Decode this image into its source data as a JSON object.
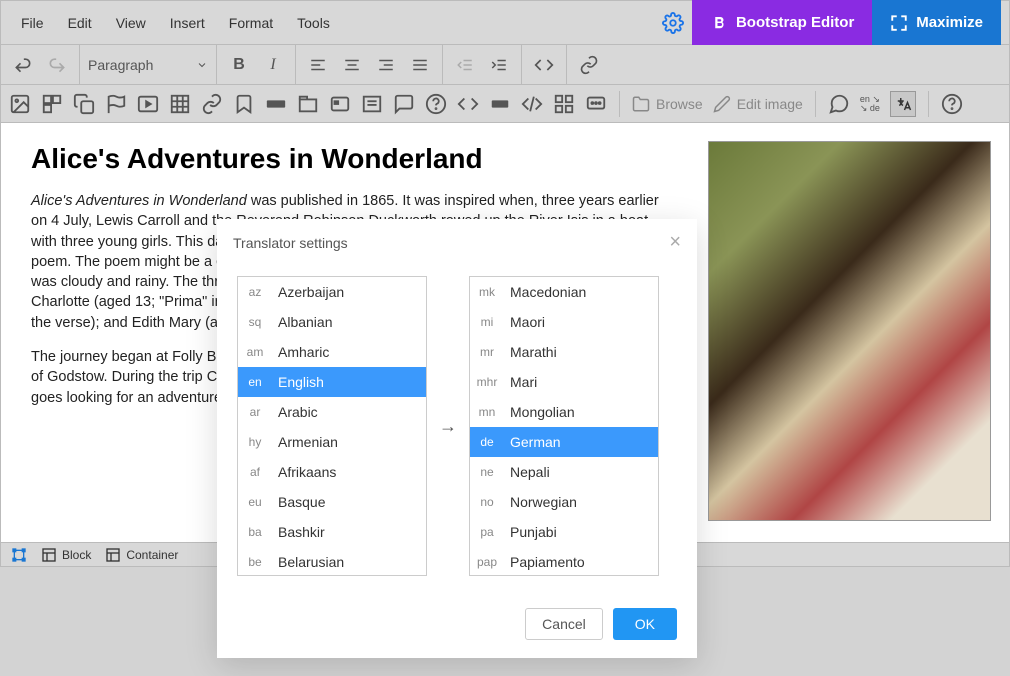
{
  "menubar": {
    "items": [
      "File",
      "Edit",
      "View",
      "Insert",
      "Format",
      "Tools"
    ],
    "bootstrap": "Bootstrap Editor",
    "maximize": "Maximize"
  },
  "toolbar": {
    "paragraph": "Paragraph",
    "browse": "Browse",
    "editimage": "Edit image",
    "lang_from": "en",
    "lang_arrow": "↘",
    "lang_to": "de"
  },
  "status": {
    "block": "Block",
    "container": "Container"
  },
  "content": {
    "title": "Alice's Adventures in Wonderland",
    "p1_em": "Alice's Adventures in Wonderland",
    "p1_rest": " was published in 1865. It was inspired when, three years earlier on 4 July, Lewis Carroll and the Reverend Robinson Duckworth rowed up the River Isis in a boat with three young girls. This day was known as the \"golden afternoon,\" prefaced in the novel as a poem. The poem might be a confusion or even another Alice-tale, for it turns out that particular day was cloudy and rainy. The three girls would be the daughters of scholar Henry Liddell: Lorina Charlotte (aged 13; \"Prima\" in the book's prefatory verse); Alice Pleasance (aged 10; \"Secunda\" in the verse); and Edith Mary (aged 8; \"Tertia\" in the verse).",
    "p2": "The journey began at Folly Bridge near Oxford and ended five miles away in the Oxfordshire village of Godstow. During the trip Charles Dodgson told the girls a story that featured a bored Alice who goes looking for an adventure. The girls loved it, and Alice asked Dodgson to write it down for her."
  },
  "modal": {
    "title": "Translator settings",
    "arrow": "→",
    "cancel": "Cancel",
    "ok": "OK",
    "source": [
      {
        "code": "az",
        "name": "Azerbaijan"
      },
      {
        "code": "sq",
        "name": "Albanian"
      },
      {
        "code": "am",
        "name": "Amharic"
      },
      {
        "code": "en",
        "name": "English",
        "selected": true
      },
      {
        "code": "ar",
        "name": "Arabic"
      },
      {
        "code": "hy",
        "name": "Armenian"
      },
      {
        "code": "af",
        "name": "Afrikaans"
      },
      {
        "code": "eu",
        "name": "Basque"
      },
      {
        "code": "ba",
        "name": "Bashkir"
      },
      {
        "code": "be",
        "name": "Belarusian"
      }
    ],
    "target": [
      {
        "code": "mk",
        "name": "Macedonian"
      },
      {
        "code": "mi",
        "name": "Maori"
      },
      {
        "code": "mr",
        "name": "Marathi"
      },
      {
        "code": "mhr",
        "name": "Mari"
      },
      {
        "code": "mn",
        "name": "Mongolian"
      },
      {
        "code": "de",
        "name": "German",
        "selected": true
      },
      {
        "code": "ne",
        "name": "Nepali"
      },
      {
        "code": "no",
        "name": "Norwegian"
      },
      {
        "code": "pa",
        "name": "Punjabi"
      },
      {
        "code": "pap",
        "name": "Papiamento"
      }
    ]
  }
}
